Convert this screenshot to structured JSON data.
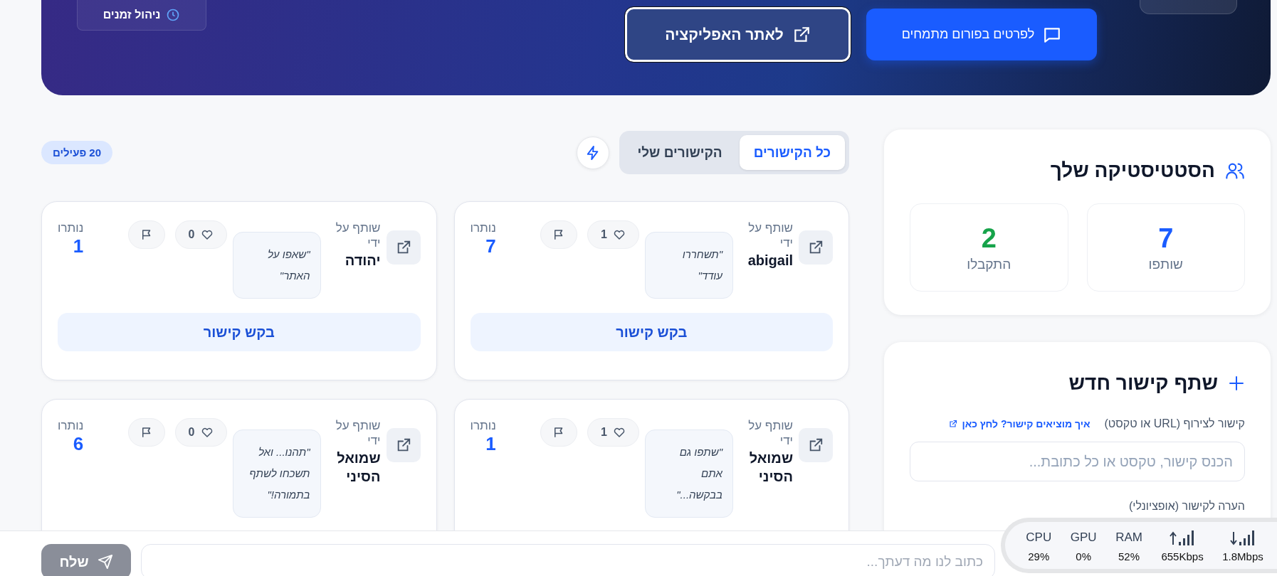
{
  "header": {
    "time_chip": "ניהול זמנים",
    "buttons": [
      {
        "label": "לפרטים בפורום מתמחים",
        "kind": "primary"
      },
      {
        "label": "לאתר האפליקציה",
        "kind": "outline"
      }
    ]
  },
  "stats": {
    "title": "הסטטיסטיקה שלך",
    "items": [
      {
        "value": "7",
        "label": "שותפו",
        "color": "#1a5cff"
      },
      {
        "value": "2",
        "label": "התקבלו",
        "color": "#16a34a"
      }
    ]
  },
  "share_form": {
    "title": "שתף קישור חדש",
    "link_label": "קישור לצירוף (URL או טקסט)",
    "help_link": "איך מוציאים קישור? לחץ כאן",
    "link_placeholder": "הכנס קישור, טקסט או כל כתובת...",
    "note_label": "הערה לקישור (אופציונלי)"
  },
  "tabs": [
    {
      "label": "כל הקישורים",
      "selected": true
    },
    {
      "label": "הקישורים שלי",
      "selected": false
    }
  ],
  "active_badge": "20 פעילים",
  "cards": [
    {
      "shared_by_label": "שותף על ידי",
      "name": "abigail",
      "quote": "\"תשחררו עודד\"",
      "likes": "1",
      "remaining_label": "נותרו",
      "remaining": "7",
      "button": "בקש קישור"
    },
    {
      "shared_by_label": "שותף על ידי",
      "name": "יהודה",
      "quote": "\"שאפו על האתר\"",
      "likes": "0",
      "remaining_label": "נותרו",
      "remaining": "1",
      "button": "בקש קישור"
    },
    {
      "shared_by_label": "שותף על ידי",
      "name": "שמואל הסיני",
      "quote": "\"שתפו גם אתם בבקשה...\"",
      "likes": "1",
      "remaining_label": "נותרו",
      "remaining": "1"
    },
    {
      "shared_by_label": "שותף על ידי",
      "name": "שמואל הסיני",
      "quote": "\"תהנו... ואל תשכחו לשתף בתמורה!\"",
      "likes": "0",
      "remaining_label": "נותרו",
      "remaining": "6"
    }
  ],
  "feedback": {
    "placeholder": "כתוב לנו מה דעתך...",
    "send": "שלח"
  },
  "system_monitor": [
    {
      "kind": "download",
      "value": "1.8Mbps"
    },
    {
      "kind": "upload",
      "value": "655Kbps"
    },
    {
      "kind": "text",
      "label": "RAM",
      "value": "52%"
    },
    {
      "kind": "text",
      "label": "GPU",
      "value": "0%"
    },
    {
      "kind": "text",
      "label": "CPU",
      "value": "29%"
    }
  ]
}
